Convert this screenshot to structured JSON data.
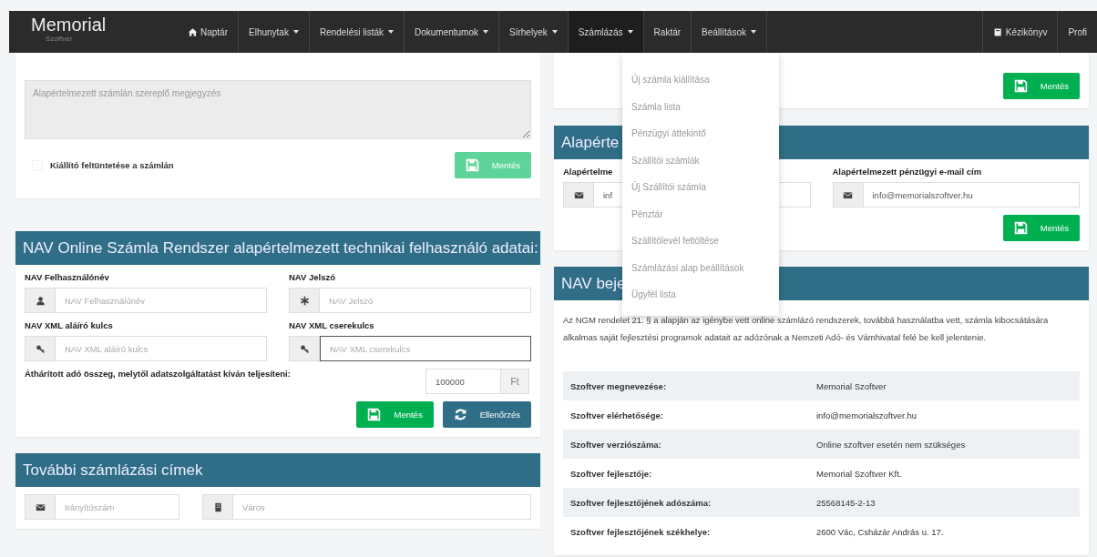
{
  "navbar": {
    "logo": {
      "title": "Memorial",
      "subtitle": "Szoftver"
    },
    "items": [
      {
        "label": "Naptár",
        "has_menu": false,
        "open": false
      },
      {
        "label": "Elhunytak",
        "has_menu": true,
        "open": false
      },
      {
        "label": "Rendelési listák",
        "has_menu": true,
        "open": false
      },
      {
        "label": "Dokumentumok",
        "has_menu": true,
        "open": false
      },
      {
        "label": "Sírhelyek",
        "has_menu": true,
        "open": false
      },
      {
        "label": "Számlázás",
        "has_menu": true,
        "open": true
      },
      {
        "label": "Raktár",
        "has_menu": false,
        "open": false
      },
      {
        "label": "Beállítások",
        "has_menu": true,
        "open": false
      }
    ],
    "right_items": [
      {
        "label": "Kézikönyv",
        "has_menu": false,
        "open": false
      },
      {
        "label": "Profi",
        "has_menu": false,
        "open": false
      }
    ]
  },
  "dropdown": {
    "items": [
      "Új számla kiállítása",
      "Számla lista",
      "Pénzügyi áttekintő",
      "Szállítói számlák",
      "Új Szállítói számla",
      "Pénztár",
      "Szállítólevél feltöltése",
      "Számlázási alap beállítások",
      "Ügyfél lista"
    ]
  },
  "left_panels": [
    {
      "blocks": [
        {
          "kind": "textarea",
          "placeholder": "Alapértelmezett számlán szereplő megjegyzés"
        },
        {
          "kind": "checkbox_row",
          "label": "Kiállító feltüntetése a számlán",
          "checked": false,
          "buttons": [
            {
              "label": "Mentés",
              "kind": "save",
              "disabled": true
            }
          ]
        }
      ]
    },
    {
      "header": "NAV Online Számla Rendszer alapértelmezett technikai felhasználó adatai:",
      "blocks": [
        {
          "kind": "fields",
          "fields": [
            {
              "label": "NAV Felhasználónév",
              "placeholder": "NAV Felhasználónév",
              "focused": false
            },
            {
              "label": "NAV Jelszó",
              "placeholder": "NAV Jelszó",
              "focused": false
            }
          ]
        },
        {
          "kind": "fields",
          "fields": [
            {
              "label": "NAV XML aláíró kulcs",
              "placeholder": "NAV XML aláíró kulcs",
              "focused": false
            },
            {
              "label": "NAV XML cserekulcs",
              "placeholder": "NAV XML cserekulcs",
              "focused": true
            }
          ]
        },
        {
          "kind": "amount",
          "label": "Áthárított adó összeg, melytől adatszolgáltatást kíván teljesíteni:",
          "value": "100000",
          "unit": "Ft"
        },
        {
          "kind": "buttons",
          "buttons": [
            {
              "label": "Mentés",
              "kind": "save",
              "disabled": false
            },
            {
              "label": "Ellenőrzés",
              "kind": "check",
              "disabled": false
            }
          ]
        }
      ]
    },
    {
      "header": "További számlázási címek",
      "blocks": [
        {
          "kind": "address",
          "fields": [
            {
              "placeholder": "Irányítószám",
              "focused": false
            },
            {
              "placeholder": "Város",
              "focused": false
            }
          ]
        }
      ]
    }
  ],
  "right_panels": [
    {
      "blocks": [
        {
          "kind": "buttons",
          "buttons": [
            {
              "label": "Mentés",
              "kind": "save",
              "disabled": false
            }
          ]
        }
      ]
    },
    {
      "header": "Alapérte",
      "blocks": [
        {
          "kind": "fields",
          "fields": [
            {
              "label": "Alapértelme",
              "value": "inf",
              "focused": false
            },
            {
              "label": "Alapértelmezett pénzügyi e-mail cím",
              "value": "info@memorialszoftver.hu",
              "focused": false
            }
          ]
        },
        {
          "kind": "buttons",
          "buttons": [
            {
              "label": "Mentés",
              "kind": "save",
              "disabled": false
            }
          ]
        }
      ]
    },
    {
      "header": "NAV beje",
      "blocks": [
        {
          "kind": "paragraph",
          "text": "Az NGM rendelet 21. § a alapján az igénybe vett online számlázó rendszerek, továbbá használatba vett, számla kibocsátására alkalmas saját fejlesztési programok adatait az adózónak a Nemzeti Adó- és Vámhivatal felé be kell jelentenie."
        },
        {
          "kind": "info_table",
          "rows": [
            {
              "label": "Szoftver megnevezése:",
              "value": "Memorial Szoftver"
            },
            {
              "label": "Szoftver elérhetősége:",
              "value": "info@memorialszoftver.hu"
            },
            {
              "label": "Szoftver verziószáma:",
              "value": "Online szoftver esetén nem szükséges"
            },
            {
              "label": "Szoftver fejlesztője:",
              "value": "Memorial Szoftver Kft."
            },
            {
              "label": "Szoftver fejlesztőjének adószáma:",
              "value": "25568145-2-13"
            },
            {
              "label": "Szoftver fejlesztőjének székhelye:",
              "value": "2600 Vác, Csházár András u. 17."
            }
          ]
        }
      ]
    }
  ]
}
